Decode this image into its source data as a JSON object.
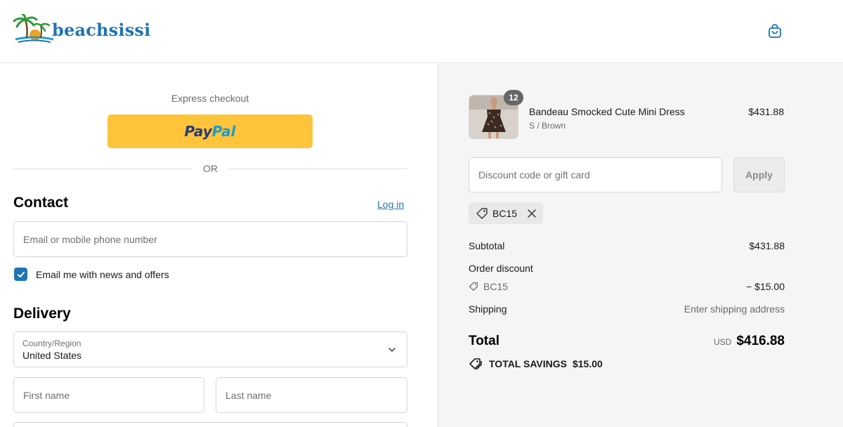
{
  "header": {
    "brand": "beachsissi",
    "logo_icon": "palm-tree-sun-logo",
    "cart_icon": "shopping-bag-icon"
  },
  "express": {
    "label": "Express checkout",
    "paypal_part1": "Pay",
    "paypal_part2": "Pal",
    "divider": "OR"
  },
  "contact": {
    "title": "Contact",
    "login_link": "Log in",
    "email_placeholder": "Email or mobile phone number",
    "newsletter_label": "Email me with news and offers",
    "newsletter_checked": true
  },
  "delivery": {
    "title": "Delivery",
    "country_label": "Country/Region",
    "country_value": "United States",
    "first_name_placeholder": "First name",
    "last_name_placeholder": "Last name"
  },
  "summary": {
    "item": {
      "quantity": "12",
      "name": "Bandeau Smocked Cute Mini Dress",
      "variant": "S / Brown",
      "price": "$431.88"
    },
    "discount_placeholder": "Discount code or gift card",
    "apply_label": "Apply",
    "applied_code": "BC15",
    "subtotal_label": "Subtotal",
    "subtotal_value": "$431.88",
    "order_discount_label": "Order discount",
    "order_discount_code": "BC15",
    "order_discount_value": "− $15.00",
    "shipping_label": "Shipping",
    "shipping_value": "Enter shipping address",
    "total_label": "Total",
    "total_currency": "USD",
    "total_value": "$416.88",
    "savings_label": "TOTAL SAVINGS",
    "savings_value": "$15.00"
  },
  "colors": {
    "accent": "#1f74b5",
    "paypal_yellow": "#ffc439",
    "summary_bg": "#f5f5f5"
  }
}
